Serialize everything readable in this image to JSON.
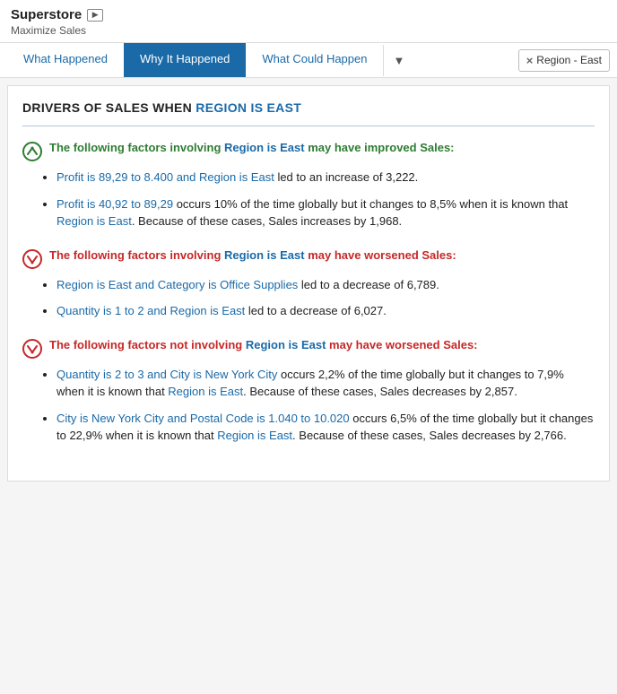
{
  "header": {
    "title": "Superstore",
    "subtitle": "Maximize Sales",
    "play_icon": "▶"
  },
  "nav": {
    "tabs": [
      {
        "label": "What Happened",
        "active": false
      },
      {
        "label": "Why It Happened",
        "active": true
      },
      {
        "label": "What Could Happen",
        "active": false
      }
    ],
    "dropdown_icon": "▼",
    "filter_chip": "Region - East",
    "filter_chip_x": "×"
  },
  "main": {
    "section_heading_prefix": "DRIVERS OF SALES WHEN ",
    "section_heading_highlight": "REGION IS EAST",
    "blocks": [
      {
        "type": "improved",
        "heading_prefix": "The following factors involving ",
        "heading_link": "Region is East",
        "heading_suffix": " may have improved Sales:",
        "bullets": [
          {
            "link_text": "Profit is 89,29 to 8.400 and Region is East",
            "rest": " led to an increase of 3,222."
          },
          {
            "link_text": "Profit is 40,92 to 89,29",
            "rest": " occurs 10% of the time globally but it changes to 8,5% when it is known that ",
            "link2": "Region is East",
            "rest2": ". Because of these cases, Sales increases by 1,968."
          }
        ]
      },
      {
        "type": "worsened",
        "heading_prefix": "The following factors involving ",
        "heading_link": "Region is East",
        "heading_suffix": " may have worsened Sales:",
        "bullets": [
          {
            "link_text": "Region is East and Category is Office Supplies",
            "rest": " led to a decrease of 6,789."
          },
          {
            "link_text": "Quantity is 1 to 2 and Region is East",
            "rest": " led to a decrease of 6,027."
          }
        ]
      },
      {
        "type": "worsened-not",
        "heading_prefix": "The following factors not involving ",
        "heading_link": "Region is East",
        "heading_suffix": " may have worsened Sales:",
        "bullets": [
          {
            "link_text": "Quantity is 2 to 3 and City is New York City",
            "rest": " occurs 2,2% of the time globally but it changes to 7,9% when it is known that ",
            "link2": "Region is East",
            "rest2": ". Because of these cases, Sales decreases by 2,857."
          },
          {
            "link_text": "City is New York City and Postal Code is 1.040 to 10.020",
            "rest": " occurs 6,5% of the time globally but it changes to 22,9% when it is known that ",
            "link2": "Region is East",
            "rest2": ". Because of these cases, Sales decreases by 2,766."
          }
        ]
      }
    ]
  }
}
